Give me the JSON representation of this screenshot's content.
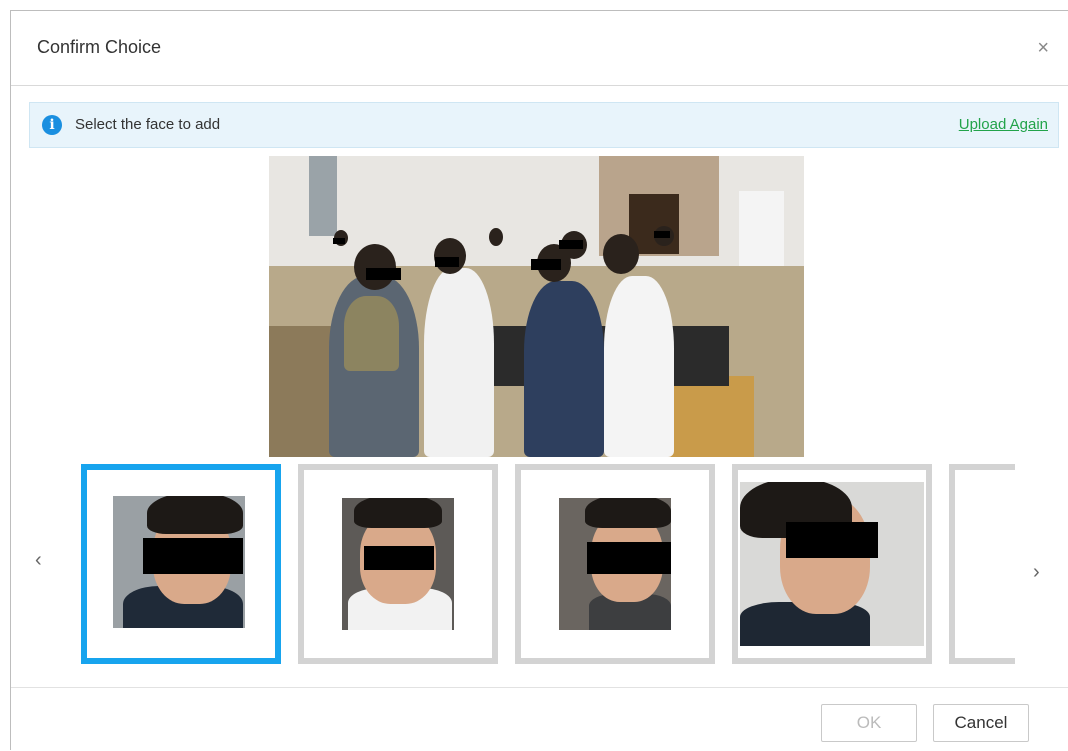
{
  "dialog": {
    "title": "Confirm Choice",
    "close_glyph": "×"
  },
  "info": {
    "icon": "info-icon",
    "message": "Select the face to add",
    "upload_again": "Upload Again"
  },
  "carousel": {
    "prev_glyph": "‹",
    "next_glyph": "›",
    "selected_index": 0,
    "visible_faces": 4,
    "partial_fifth": true
  },
  "buttons": {
    "ok": "OK",
    "cancel": "Cancel"
  },
  "colors": {
    "accent": "#17a4ee",
    "link": "#22a34a",
    "info_bg": "#e8f4fb"
  }
}
